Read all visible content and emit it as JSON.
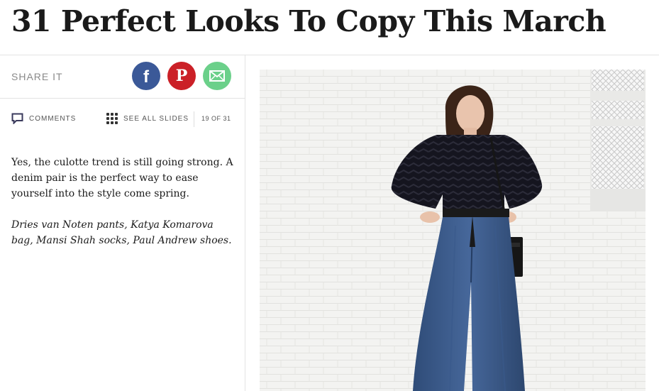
{
  "article": {
    "title": "31 Perfect Looks To Copy This March"
  },
  "share": {
    "label": "SHARE IT",
    "buttons": [
      {
        "network": "facebook",
        "icon": "facebook-icon",
        "color": "#3b5998"
      },
      {
        "network": "pinterest",
        "icon": "pinterest-icon",
        "color": "#cb2027"
      },
      {
        "network": "email",
        "icon": "mail-icon",
        "color": "#6bd08a"
      }
    ]
  },
  "toolbar": {
    "comments_label": "COMMENTS",
    "comments_icon": "comment-icon",
    "see_all_label": "SEE ALL SLIDES",
    "see_all_icon": "grid-icon",
    "slide_counter": "19 OF 31"
  },
  "slide": {
    "caption": "Yes, the culotte trend is still going strong. A denim pair is the perfect way to ease yourself into the style come spring.",
    "credits": "Dries van Noten pants, Katya Komarova bag, Mansi Shah socks, Paul Andrew shoes."
  }
}
